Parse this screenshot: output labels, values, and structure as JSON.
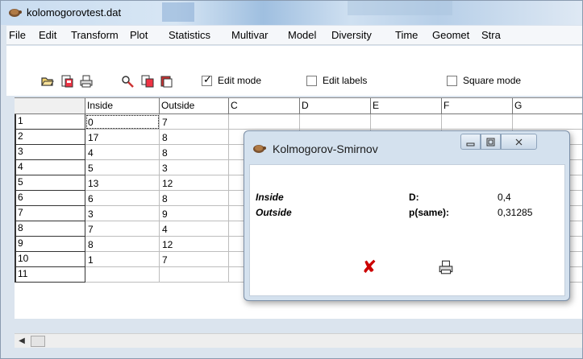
{
  "window": {
    "title": "kolomogorovtest.dat"
  },
  "menu": [
    "File",
    "Edit",
    "Transform",
    "Plot",
    "Statistics",
    "Multivar",
    "Model",
    "Diversity",
    "Time",
    "Geomet",
    "Stra"
  ],
  "toolbar": {
    "buttons": [
      "open-icon",
      "save-icon",
      "print-icon",
      "search-icon",
      "copy-icon",
      "paste-icon"
    ],
    "edit_mode": {
      "label": "Edit mode",
      "checked": true
    },
    "edit_labels": {
      "label": "Edit labels",
      "checked": false
    },
    "square_mode": {
      "label": "Square mode",
      "checked": false
    }
  },
  "grid": {
    "columns": [
      "Inside",
      "Outside",
      "C",
      "D",
      "E",
      "F",
      "G"
    ],
    "row_labels": [
      "1",
      "2",
      "3",
      "4",
      "5",
      "6",
      "7",
      "8",
      "9",
      "10",
      "11"
    ],
    "rows": [
      [
        "0",
        "7"
      ],
      [
        "17",
        "8"
      ],
      [
        "4",
        "8"
      ],
      [
        "5",
        "3"
      ],
      [
        "13",
        "12"
      ],
      [
        "6",
        "8"
      ],
      [
        "3",
        "9"
      ],
      [
        "7",
        "4"
      ],
      [
        "8",
        "12"
      ],
      [
        "1",
        "7"
      ],
      [
        "",
        ""
      ]
    ]
  },
  "dialog": {
    "title": "Kolmogorov-Smirnov",
    "series1": "Inside",
    "series2": "Outside",
    "d_label": "D:",
    "d_value": "0,4",
    "p_label": "p(same):",
    "p_value": "0,31285",
    "close_glyph": "✘",
    "colors": {
      "close": "#cc0000"
    }
  }
}
